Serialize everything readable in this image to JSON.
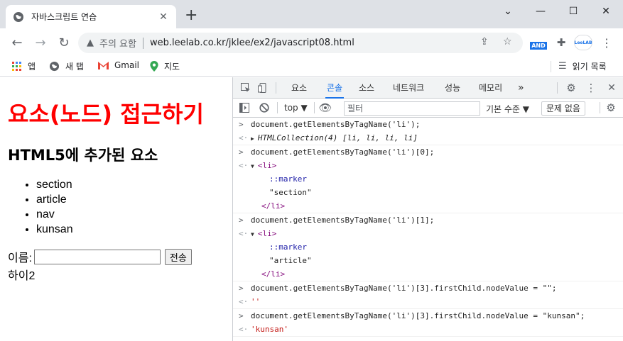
{
  "browser": {
    "tab_title": "자바스크립트 연습",
    "tab_close": "✕",
    "new_tab": "+",
    "window_controls": {
      "minimize": "⌄",
      "restore": "—",
      "maximize": "☐",
      "close": "✕"
    },
    "address": {
      "security_label": "주의 요함",
      "url": "web.leelab.co.kr/jklee/ex2/javascript08.html"
    },
    "extensions": {
      "and_label": "AND",
      "leelab_label": "LeeLAB"
    },
    "bookmarks": [
      {
        "label": "앱",
        "icon": "apps-grid-icon"
      },
      {
        "label": "새 탭",
        "icon": "globe-icon"
      },
      {
        "label": "Gmail",
        "icon": "gmail-icon"
      },
      {
        "label": "지도",
        "icon": "maps-pin-icon"
      }
    ],
    "reading_list": "읽기 목록"
  },
  "page": {
    "heading": "요소(노드) 접근하기",
    "subheading": "HTML5에 추가된 요소",
    "list_items": [
      "section",
      "article",
      "nav",
      "kunsan"
    ],
    "form": {
      "label": "이름:",
      "input_value": "",
      "submit_label": "전송"
    },
    "result_text": "하이2"
  },
  "devtools": {
    "tabs": [
      "요소",
      "콘솔",
      "소스",
      "네트워크",
      "성능",
      "메모리"
    ],
    "active_tab": "콘솔",
    "more_tabs": "»",
    "filter": {
      "context": "top ▼",
      "placeholder": "필터",
      "level": "기본 수준 ▼",
      "issues": "문제 없음"
    },
    "console": {
      "e1_cmd": "document.getElementsByTagName('li');",
      "e1_result": "HTMLCollection(4) [li, li, li, li]",
      "e2_cmd": "document.getElementsByTagName('li')[0];",
      "e2_open": "<li>",
      "e2_marker": "::marker",
      "e2_text": "\"section\"",
      "e2_close": "</li>",
      "e3_cmd": "document.getElementsByTagName('li')[1];",
      "e3_open": "<li>",
      "e3_marker": "::marker",
      "e3_text": "\"article\"",
      "e3_close": "</li>",
      "e4_cmd": "document.getElementsByTagName('li')[3].firstChild.nodeValue = \"\";",
      "e4_result": "''",
      "e5_cmd": "document.getElementsByTagName('li')[3].firstChild.nodeValue = \"kunsan\";",
      "e5_result": "'kunsan'"
    }
  },
  "colors": {
    "heading_red": "#ff0000",
    "devtools_active": "#1a73e8",
    "string_red": "#c41a16",
    "tag_purple": "#881280"
  }
}
